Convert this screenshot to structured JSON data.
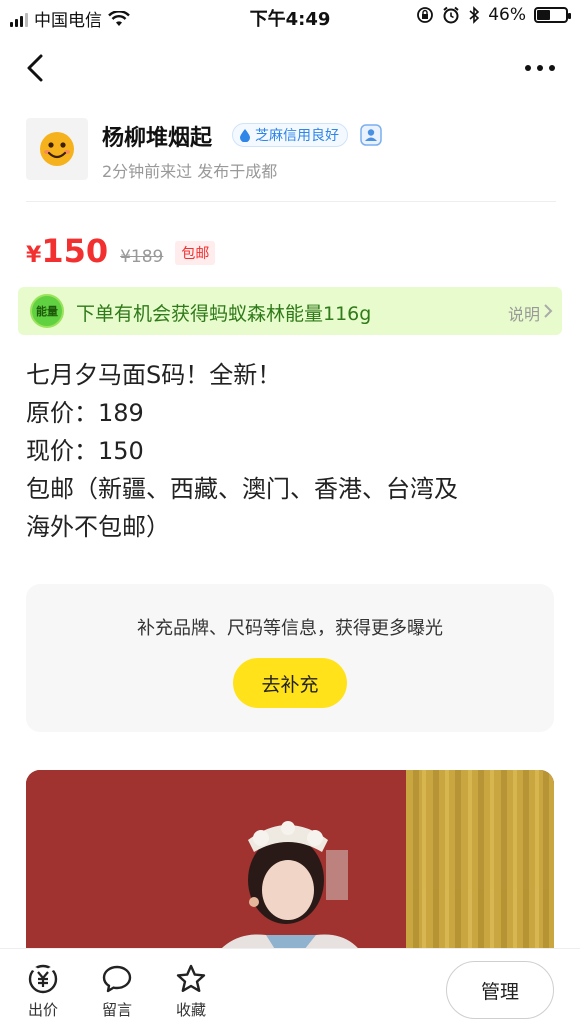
{
  "status_bar": {
    "carrier": "中国电信",
    "time": "下午4:49",
    "battery_percent_text": "46%",
    "battery_level": 0.46
  },
  "seller": {
    "name": "杨柳堆烟起",
    "credit_badge": "芝麻信用良好",
    "meta": "2分钟前来过  发布于成都"
  },
  "price": {
    "currency": "¥",
    "current": "150",
    "original": "¥189",
    "shipping_tag": "包邮"
  },
  "energy": {
    "badge": "能量",
    "text": "下单有机会获得蚂蚁森林能量116g",
    "explain": "说明"
  },
  "description": {
    "lines": [
      "七月夕马面S码！全新！",
      "原价：189",
      "现价：150",
      "包邮（新疆、西藏、澳门、香港、台湾及",
      "海外不包邮）"
    ]
  },
  "supplement": {
    "text": "补充品牌、尺码等信息，获得更多曝光",
    "button": "去补充"
  },
  "bottom_bar": {
    "items": [
      {
        "label": "出价",
        "icon": "yuan-circle-icon"
      },
      {
        "label": "留言",
        "icon": "comment-bubble-icon"
      },
      {
        "label": "收藏",
        "icon": "star-icon"
      }
    ],
    "manage": "管理"
  },
  "colors": {
    "price_red": "#f23030",
    "energy_bg": "#e8fbcc",
    "energy_text": "#2f7a1a",
    "button_yellow": "#ffe21a",
    "credit_blue": "#2f86e8"
  }
}
